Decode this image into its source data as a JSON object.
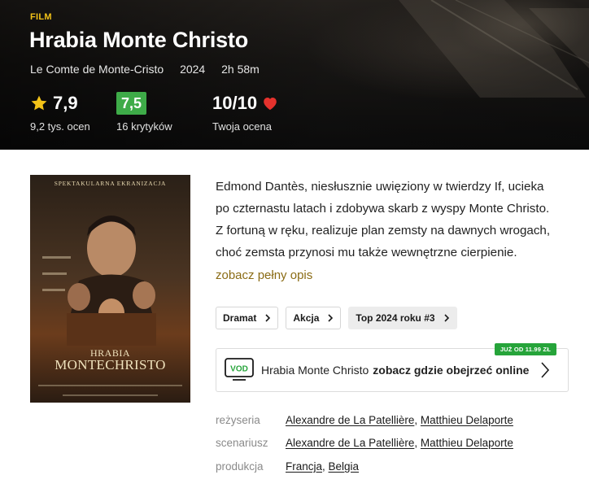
{
  "header": {
    "category": "FILM",
    "title": "Hrabia Monte Christo",
    "original_title": "Le Comte de Monte-Cristo",
    "year": "2024",
    "duration": "2h 58m"
  },
  "ratings": {
    "users": {
      "value": "7,9",
      "count_label": "9,2 tys. ocen"
    },
    "critics": {
      "value": "7,5",
      "count_label": "16 krytyków",
      "badge_color": "#3eab48"
    },
    "yours": {
      "value": "10/10",
      "label": "Twoja ocena"
    }
  },
  "poster": {
    "tagline": "SPEKTAKULARNA EKRANIZACJA",
    "title_line1": "HRABIA",
    "title_line2": "MONTECHRISTO"
  },
  "description": {
    "text": "Edmond Dantès, niesłusznie uwięziony w twierdzy If, ucieka po czternastu latach i zdobywa skarb z wyspy Monte Christo. Z fortuną w ręku, realizuje plan zemsty na dawnych wrogach, choć zemsta przynosi mu także wewnętrzne cierpienie.",
    "more_link": "zobacz pełny opis"
  },
  "tags": [
    {
      "label": "Dramat"
    },
    {
      "label": "Akcja"
    },
    {
      "label": "Top 2024 roku #3"
    }
  ],
  "vod": {
    "badge": "JUŻ OD 11.99 ZŁ",
    "logo_text": "VOD",
    "title": "Hrabia Monte Christo",
    "cta": "zobacz gdzie obejrzeć online"
  },
  "credits": {
    "directing": {
      "label": "reżyseria",
      "names": [
        "Alexandre de La Patellière",
        "Matthieu Delaporte"
      ]
    },
    "screenplay": {
      "label": "scenariusz",
      "names": [
        "Alexandre de La Patellière",
        "Matthieu Delaporte"
      ]
    },
    "production": {
      "label": "produkcja",
      "names": [
        "Francja",
        "Belgia"
      ]
    }
  },
  "colors": {
    "accent": "#f3c318",
    "link": "#8a6b14",
    "heart": "#e5322d",
    "vod_green": "#26a43a"
  }
}
